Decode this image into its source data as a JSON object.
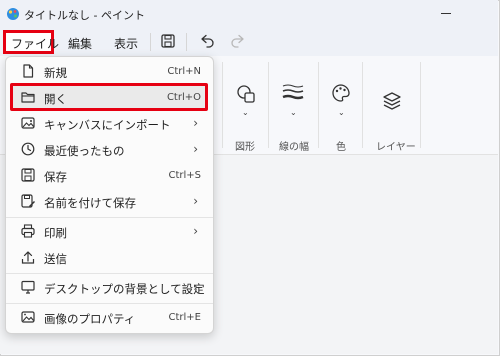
{
  "window": {
    "title": "タイトルなし - ペイント"
  },
  "menubar": {
    "file": "ファイル",
    "edit": "編集",
    "view": "表示"
  },
  "ribbon": {
    "shapes_label": "図形",
    "line_width_label": "線の幅",
    "color_label": "色",
    "layers_label": "レイヤー"
  },
  "file_menu": {
    "items": [
      {
        "label": "新規",
        "shortcut": "Ctrl+N",
        "icon": "new-file-icon"
      },
      {
        "label": "開く",
        "shortcut": "Ctrl+O",
        "icon": "open-folder-icon"
      },
      {
        "label": "キャンバスにインポート",
        "icon": "import-image-icon"
      },
      {
        "label": "最近使ったもの",
        "icon": "clock-icon"
      },
      {
        "label": "保存",
        "shortcut": "Ctrl+S",
        "icon": "save-icon"
      },
      {
        "label": "名前を付けて保存",
        "icon": "save-as-icon"
      },
      {
        "label": "印刷",
        "icon": "printer-icon"
      },
      {
        "label": "送信",
        "icon": "send-icon"
      },
      {
        "label": "デスクトップの背景として設定",
        "icon": "desktop-icon"
      },
      {
        "label": "画像のプロパティ",
        "shortcut": "Ctrl+E",
        "icon": "image-properties-icon"
      }
    ]
  },
  "colors": {
    "highlight": "#e60012",
    "accent": "#0a64c8"
  }
}
